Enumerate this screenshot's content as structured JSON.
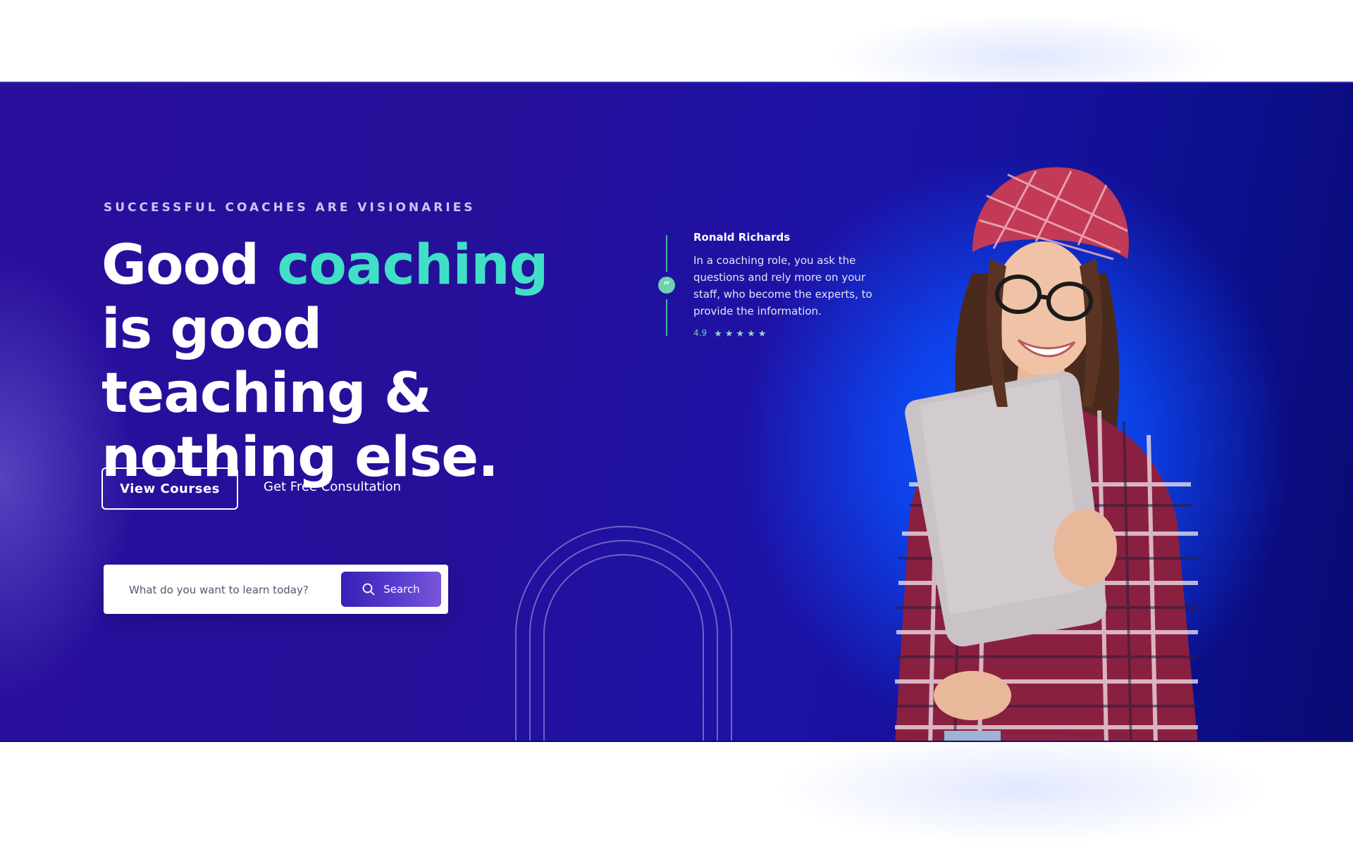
{
  "hero": {
    "eyebrow": "SUCCESSFUL COACHES ARE VISIONARIES",
    "headline": {
      "part1": "Good ",
      "accent": "coaching",
      "part2": " is good teaching & nothing else."
    },
    "primary_button": "View Courses",
    "secondary_link": "Get Free Consultation",
    "search": {
      "placeholder": "What do you want to learn today?",
      "button_label": "Search"
    }
  },
  "testimonial": {
    "name": "Ronald Richards",
    "quote": "In a coaching role, you ask the questions and rely more on your staff, who become the experts, to provide the information.",
    "rating": "4.9",
    "stars": 5,
    "quote_mark": "“"
  },
  "colors": {
    "accent": "#3fe0c5",
    "hero_bg": "#25109a",
    "glow": "#0a5cff",
    "badge": "#6fd1ae"
  },
  "icons": {
    "search_button": "search-icon",
    "rating": "star-icon",
    "testimonial_badge": "quote-icon"
  }
}
